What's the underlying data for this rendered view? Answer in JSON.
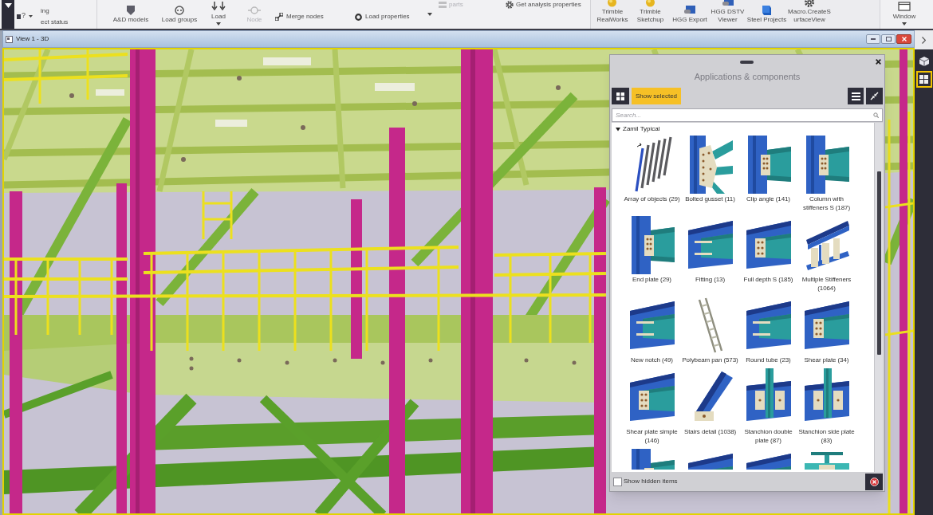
{
  "ribbon": {
    "help": {
      "glyph": "?"
    },
    "quick_access": [
      {
        "label": "ing"
      },
      {
        "label": "ect status"
      }
    ],
    "analysis_group": [
      {
        "kind": "large",
        "label": "A&D models",
        "disabled": false
      },
      {
        "kind": "large",
        "label": "Load groups",
        "disabled": false
      },
      {
        "kind": "split",
        "label": "Load",
        "disabled": false
      },
      {
        "kind": "large",
        "label": "Node",
        "disabled": true
      },
      {
        "kind": "small",
        "label": "Merge nodes",
        "disabled": false
      },
      {
        "kind": "small",
        "label": "Load properties",
        "disabled": false
      },
      {
        "kind": "dropdown",
        "disabled": false
      },
      {
        "kind": "top",
        "label": "parts",
        "disabled": true
      },
      {
        "kind": "top",
        "label": "Get analysis properties",
        "disabled": false
      }
    ],
    "extensions_group": [
      {
        "kind": "large",
        "label": "Trimble\nRealWorks"
      },
      {
        "kind": "large",
        "label": "Trimble\nSketchup"
      },
      {
        "kind": "large",
        "label": "HGG Export"
      },
      {
        "kind": "large",
        "label": "HGG DSTV\nViewer"
      },
      {
        "kind": "large",
        "label": "Steel Projects"
      },
      {
        "kind": "large",
        "label": "Macro.CreateS\nurfaceView"
      }
    ],
    "window_group": [
      {
        "kind": "split",
        "label": "Window"
      }
    ]
  },
  "view": {
    "title": "View 1 - 3D"
  },
  "side_toolbar": [
    {
      "selected": false
    },
    {
      "selected": true
    }
  ],
  "panel": {
    "title": "Applications & components",
    "show_selected": {
      "label": "Show selected"
    },
    "search": {
      "placeholder": "Search..."
    },
    "category": {
      "label": "Zamil Typical",
      "expanded": true,
      "items": [
        {
          "kind": "rods",
          "label": "Array of objects (29)"
        },
        {
          "kind": "gusset",
          "label": "Bolted gusset (11)"
        },
        {
          "kind": "column_joint",
          "label": "Clip angle (141)"
        },
        {
          "kind": "column_joint",
          "label": "Column with stiffeners S (187)"
        },
        {
          "kind": "column_joint",
          "label": "End plate (29)"
        },
        {
          "kind": "beam_joint",
          "label": "Fitting (13)"
        },
        {
          "kind": "beam_plate",
          "label": "Full depth S (185)"
        },
        {
          "kind": "stiffeners",
          "label": "Multiple Stiffeners (1064)"
        },
        {
          "kind": "beam_joint",
          "label": "New notch (49)"
        },
        {
          "kind": "ladder",
          "label": "Polybeam pan (573)"
        },
        {
          "kind": "beam_joint",
          "label": "Round tube (23)"
        },
        {
          "kind": "beam_plate",
          "label": "Shear plate (34)"
        },
        {
          "kind": "beam_plate",
          "label": "Shear plate simple (146)"
        },
        {
          "kind": "brace",
          "label": "Stairs detail (1038)"
        },
        {
          "kind": "stanchion",
          "label": "Stanchion double plate (87)"
        },
        {
          "kind": "stanchion",
          "label": "Stanchion side plate (83)"
        },
        {
          "kind": "column_joint"
        },
        {
          "kind": "beam_joint"
        },
        {
          "kind": "beam_joint"
        },
        {
          "kind": "tee"
        }
      ]
    },
    "show_hidden": {
      "label": "Show hidden items",
      "checked": false
    }
  }
}
